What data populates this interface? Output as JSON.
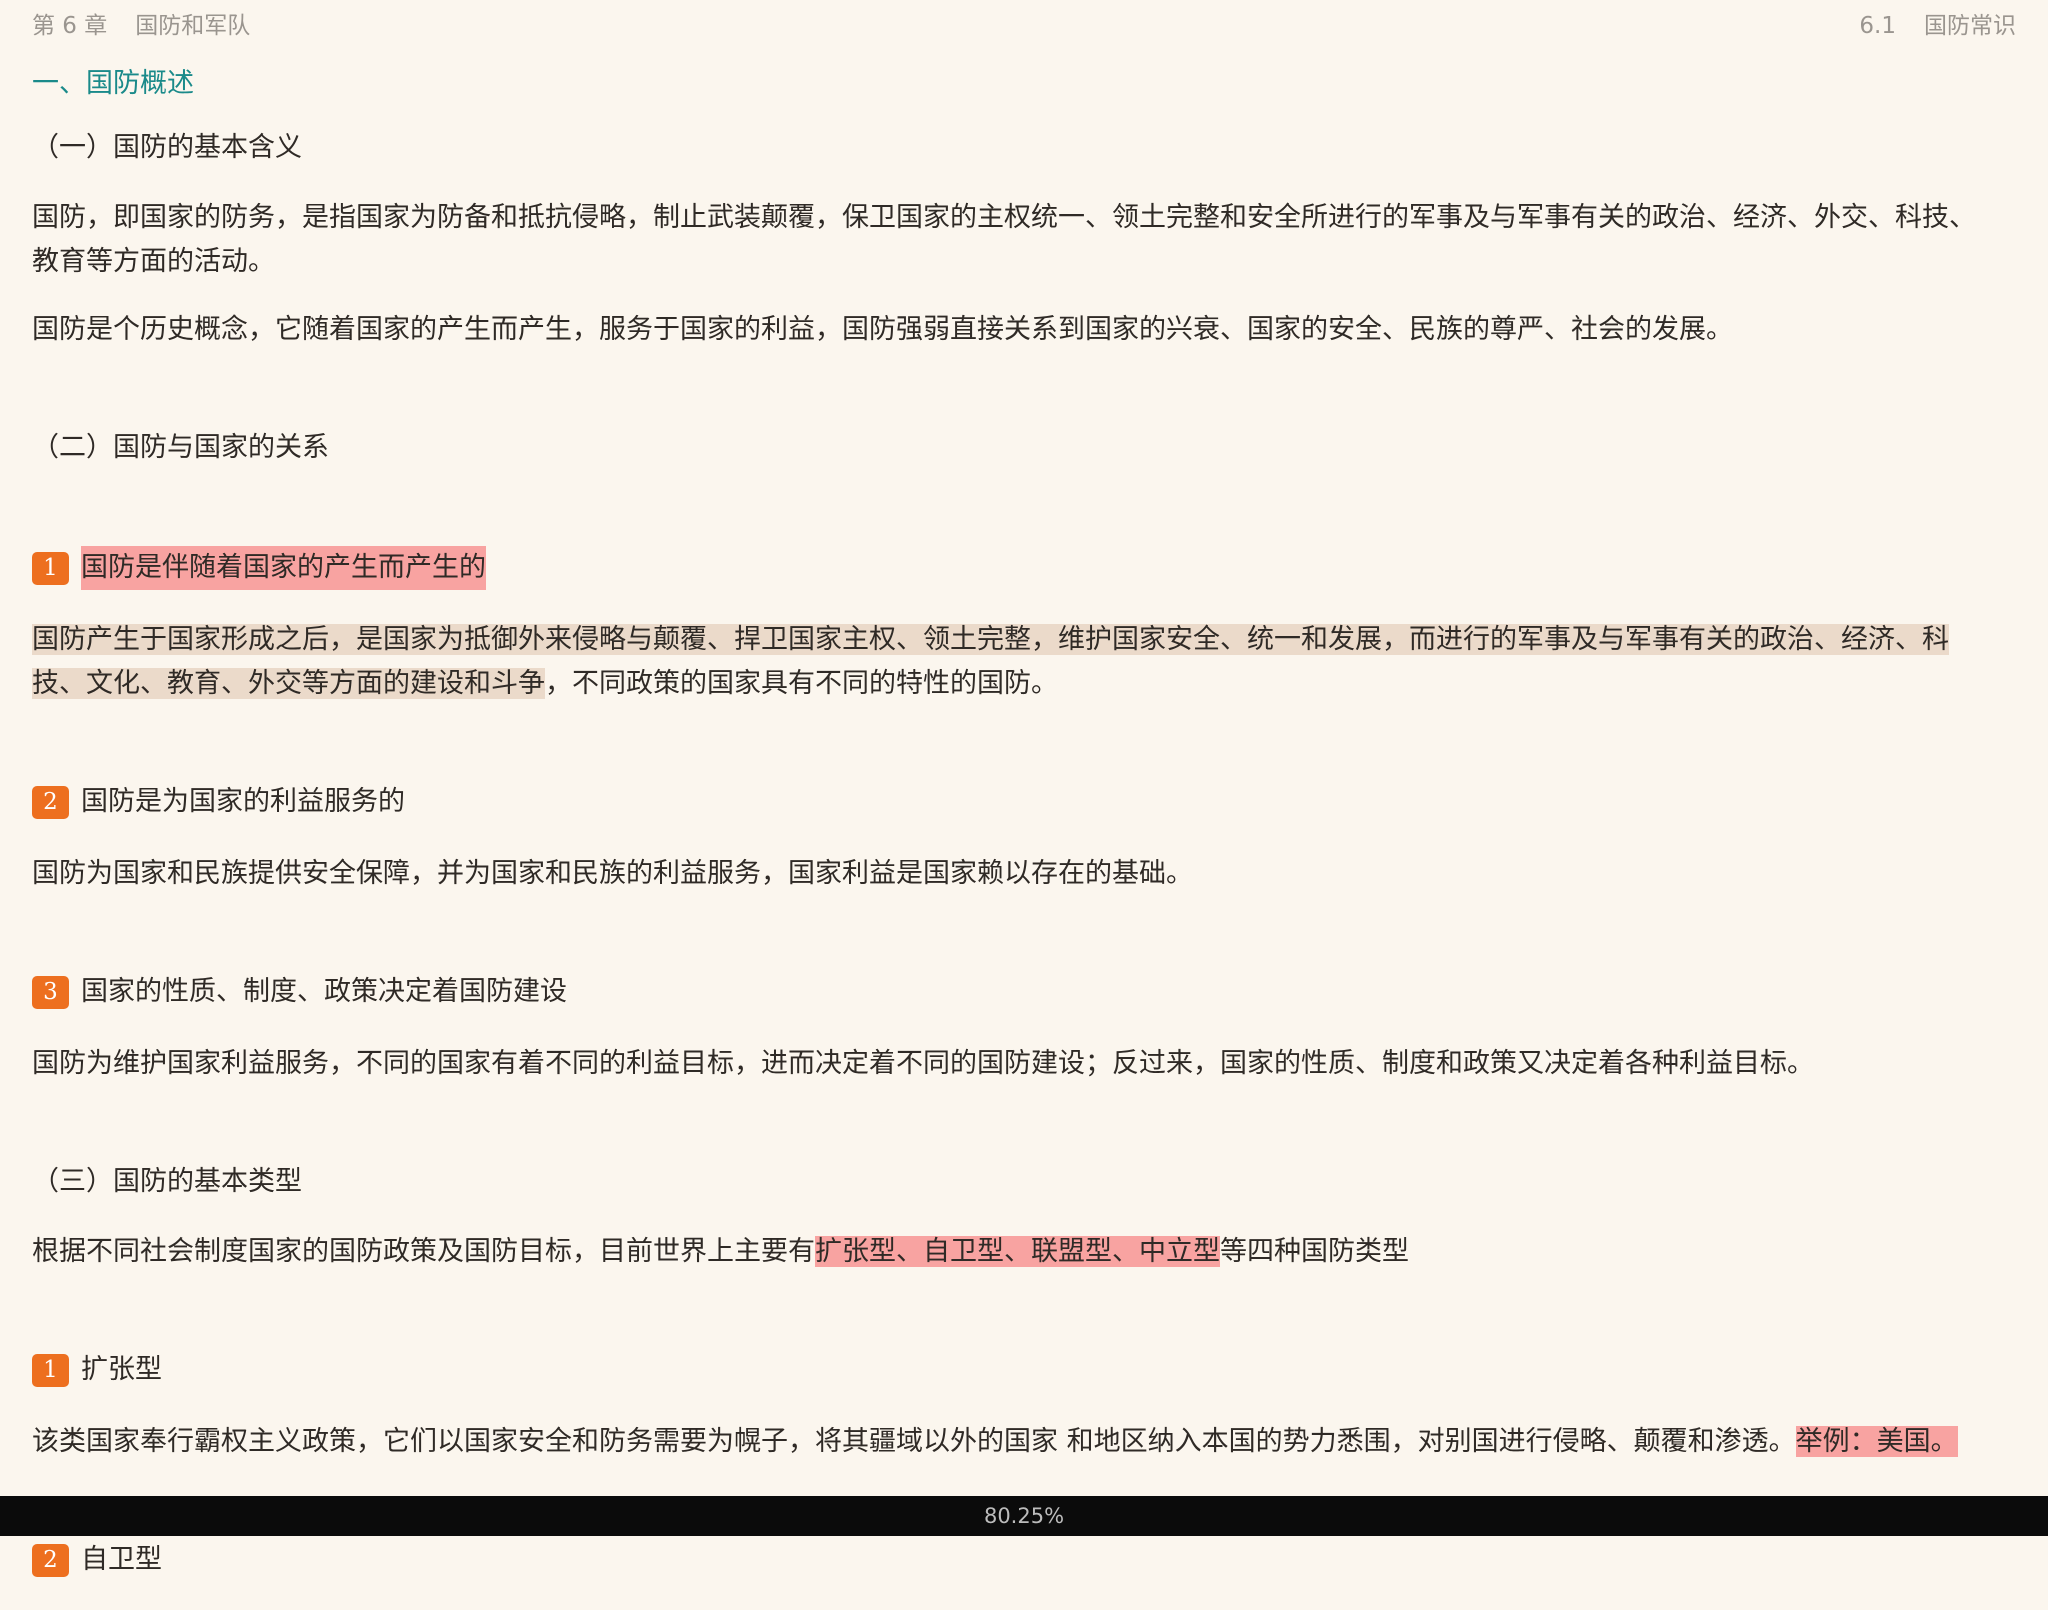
{
  "header": {
    "chapter_no": "第 6 章",
    "chapter_title": "国防和军队",
    "section_no": "6.1",
    "section_title": "国防常识"
  },
  "content": {
    "h1": "一、国防概述",
    "s1": {
      "title": "（一）国防的基本含义",
      "p1": "国防，即国家的防务，是指国家为防备和抵抗侵略，制止武装颠覆，保卫国家的主权统一、领土完整和安全所进行的军事及与军事有关的政治、经济、外交、科技、教育等方面的活动。",
      "p2": "国防是个历史概念，它随着国家的产生而产生，服务于国家的利益，国防强弱直接关系到国家的兴衰、国家的安全、民族的尊严、社会的发展。"
    },
    "s2": {
      "title": "（二）国防与国家的关系",
      "item1": {
        "num": "1",
        "title": "国防是伴随着国家的产生而产生的",
        "p_highlight": "国防产生于国家形成之后，是国家为抵御外来侵略与颠覆、捍卫国家主权、领土完整，维护国家安全、统一和发展，而进行的军事及与军事有关的政治、经济、科技、文化、教育、外交等方面的建设和斗争",
        "p_rest": "，不同政策的国家具有不同的特性的国防。"
      },
      "item2": {
        "num": "2",
        "title": "国防是为国家的利益服务的",
        "p": "国防为国家和民族提供安全保障，并为国家和民族的利益服务，国家利益是国家赖以存在的基础。"
      },
      "item3": {
        "num": "3",
        "title": "国家的性质、制度、政策决定着国防建设",
        "p": "国防为维护国家利益服务，不同的国家有着不同的利益目标，进而决定着不同的国防建设；反过来，国家的性质、制度和政策又决定着各种利益目标。"
      }
    },
    "s3": {
      "title": "（三）国防的基本类型",
      "p_pre": "根据不同社会制度国家的国防政策及国防目标，目前世界上主要有",
      "p_highlight": "扩张型、自卫型、联盟型、中立型",
      "p_post": "等四种国防类型",
      "item1": {
        "num": "1",
        "title": "扩张型",
        "p": "该类国家奉行霸权主义政策，它们以国家安全和防务需要为幌子，将其疆域以外的国家 和地区纳入本国的势力悉围，对别国进行侵略、颠覆和渗透。",
        "p_highlight": "举例：美国。"
      },
      "item2": {
        "num": "2",
        "title": "自卫型"
      }
    }
  },
  "footer": {
    "progress": "80.25%"
  },
  "colors": {
    "background": "#fbf6ee",
    "section_heading": "#1a8a8a",
    "badge": "#ed6f1f",
    "highlight_red": "#f8a3a1",
    "highlight_tan": "#ebdaca",
    "footer_bar": "#0b0b0b"
  }
}
